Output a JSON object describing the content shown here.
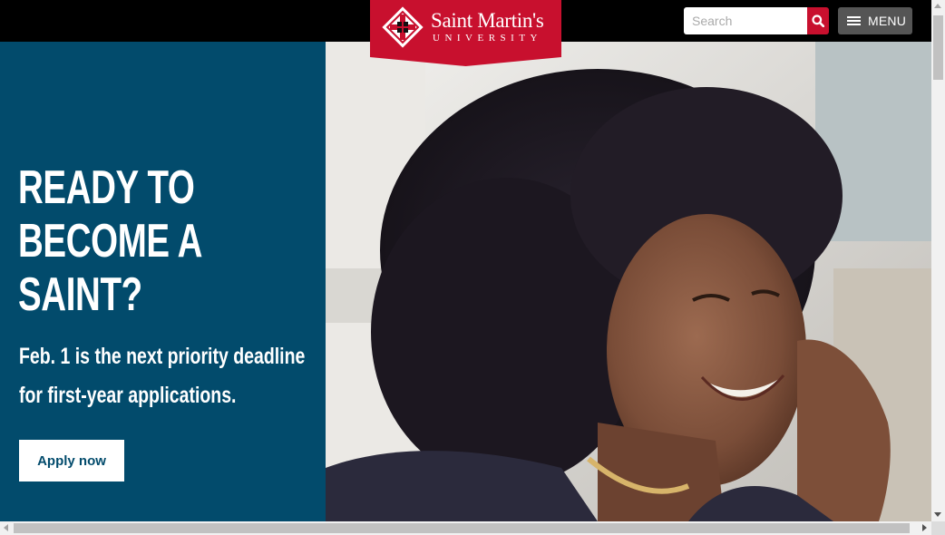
{
  "header": {
    "logo": {
      "name": "Saint Martin's",
      "subtitle": "UNIVERSITY",
      "seal_icon": "university-seal-icon",
      "banner_color": "#c8102e"
    },
    "search": {
      "placeholder": "Search",
      "value": "",
      "button_icon": "search-icon"
    },
    "menu": {
      "icon": "hamburger-icon",
      "label": "MENU"
    }
  },
  "hero": {
    "headline_lines": [
      "READY TO",
      "BECOME A",
      "SAINT?"
    ],
    "subhead_lines": [
      "Feb. 1 is the next priority deadline",
      "for first-year applications."
    ],
    "cta_label": "Apply now",
    "panel_color": "#024b6c",
    "photo": "student-smiling-photo"
  },
  "scrollbars": {
    "vertical": true,
    "horizontal": true
  }
}
